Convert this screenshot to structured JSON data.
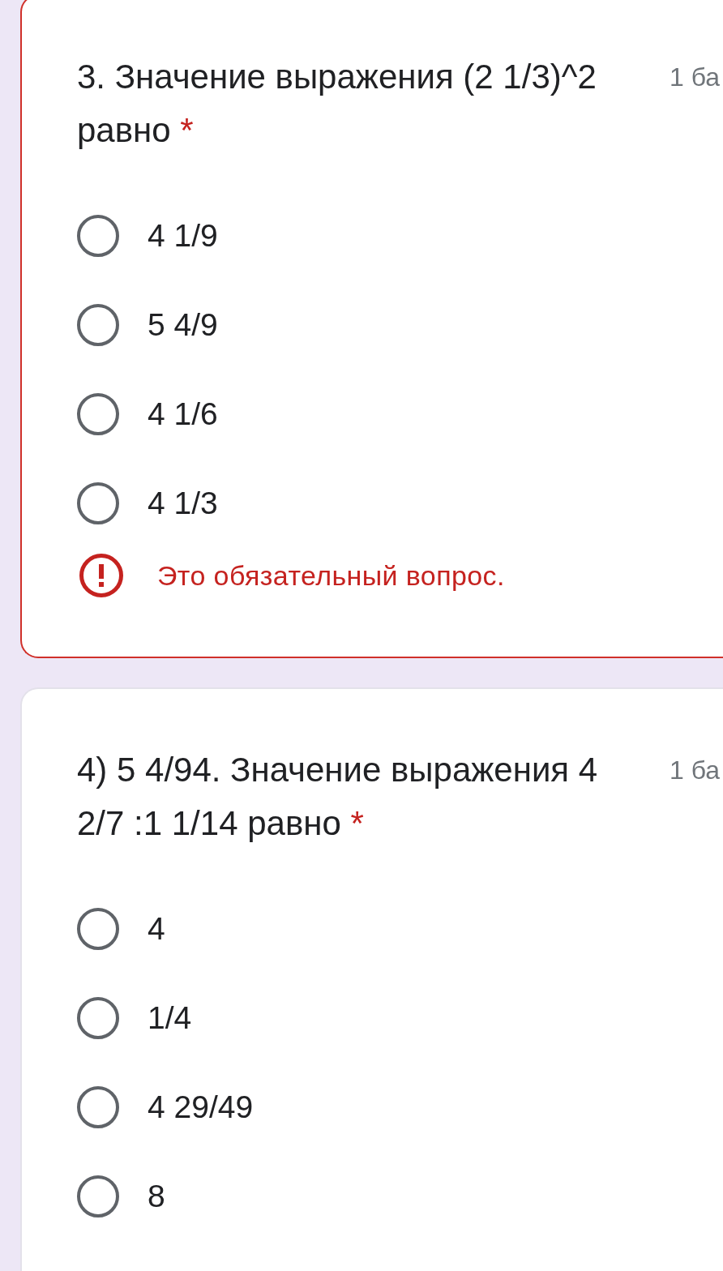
{
  "questions": [
    {
      "title": "3. Значение выражения (2 1/3)^2 равно",
      "required_mark": "*",
      "points": "1 ба",
      "options": [
        {
          "label": "4 1/9",
          "selected": false
        },
        {
          "label": "5 4/9",
          "selected": false
        },
        {
          "label": "4 1/6",
          "selected": false
        },
        {
          "label": "4 1/3",
          "selected": false
        }
      ],
      "error": "Это обязательный вопрос."
    },
    {
      "title": "4) 5 4/94. Значение выражения 4 2/7 :1 1/14 равно",
      "required_mark": "*",
      "points": "1 ба",
      "options": [
        {
          "label": "4",
          "selected": false
        },
        {
          "label": "1/4",
          "selected": false
        },
        {
          "label": "4 29/49",
          "selected": false
        },
        {
          "label": "8",
          "selected": false
        }
      ]
    }
  ]
}
